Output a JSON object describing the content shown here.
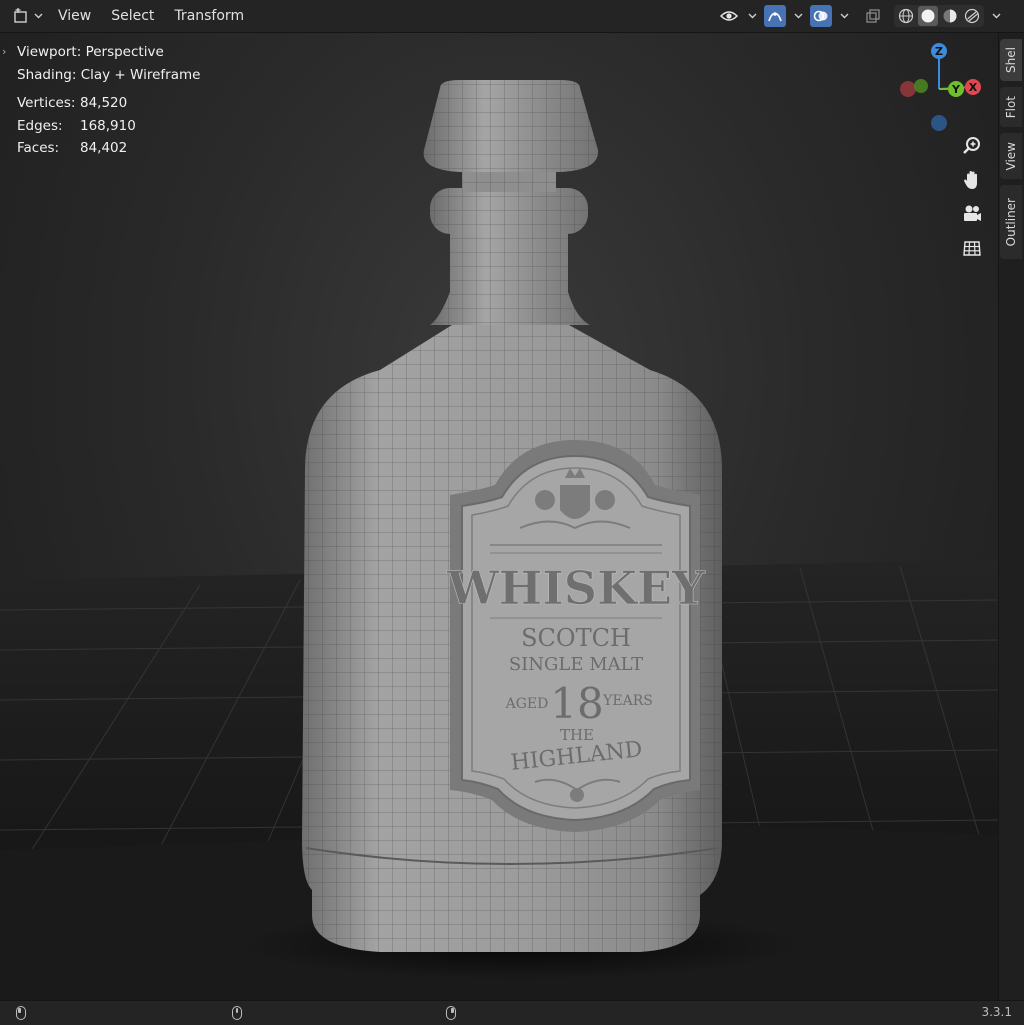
{
  "header": {
    "menu": [
      "View",
      "Select",
      "Transform"
    ]
  },
  "overlay": {
    "viewport_label": "Viewport:",
    "viewport_value": "Perspective",
    "shading_label": "Shading:",
    "shading_value": "Clay + Wireframe",
    "vertices_label": "Vertices:",
    "vertices_value": "84,520",
    "edges_label": "Edges:",
    "edges_value": "168,910",
    "faces_label": "Faces:",
    "faces_value": "84,402"
  },
  "gizmo": {
    "z": "Z",
    "y": "Y",
    "x": "X"
  },
  "label": {
    "brand": "WHISKEY",
    "line1": "SCOTCH",
    "line2": "SINGLE MALT",
    "aged": "AGED",
    "age": "18",
    "years": "YEARS",
    "the": "THE",
    "region": "HIGHLAND"
  },
  "sidetabs": [
    "Shel",
    "Flot",
    "View",
    "Outliner"
  ],
  "status": {
    "version": "3.3.1"
  },
  "colors": {
    "accent": "#4772b3",
    "axis_x": "#e0484f",
    "axis_y": "#6fbf2d",
    "axis_z": "#3d8bdc"
  }
}
